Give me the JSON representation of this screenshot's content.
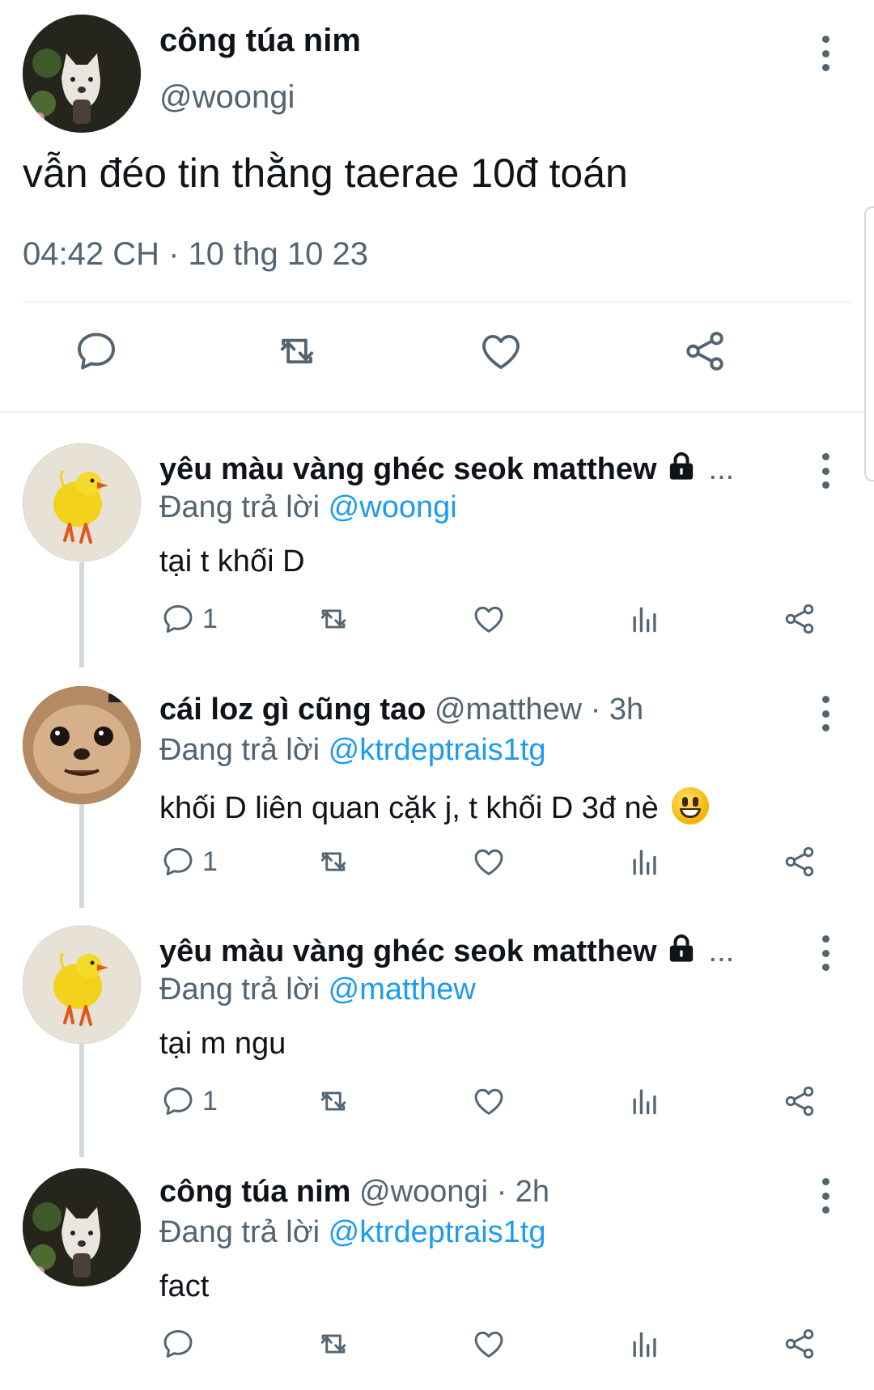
{
  "main_tweet": {
    "name": "công túa nim",
    "handle": "@woongi",
    "text": "vẫn đéo tin thằng taerae 10đ toán",
    "timestamp": "04:42 CH · 10 thg 10 23"
  },
  "replies": [
    {
      "name": "yêu màu vàng ghéc seok matthew",
      "meta": "",
      "protected": true,
      "truncated": "...",
      "replying_label": "Đang trả lời",
      "replying_to": "@woongi",
      "text": "tại t khối D",
      "reply_count": "1",
      "avatar_icon": "chick-avatar"
    },
    {
      "name": "cái loz gì cũng tao",
      "meta": "@matthew · 3h",
      "protected": false,
      "truncated": "",
      "replying_label": "Đang trả lời",
      "replying_to": "@ktrdeptrais1tg",
      "text": "khối D liên quan cặk j, t khối D 3đ nè",
      "emoji": "grinning-face-emoji",
      "reply_count": "1",
      "avatar_icon": "chihuahua-avatar"
    },
    {
      "name": "yêu màu vàng ghéc seok matthew",
      "meta": "",
      "protected": true,
      "truncated": "...",
      "replying_label": "Đang trả lời",
      "replying_to": "@matthew",
      "text": "tại m ngu",
      "reply_count": "1",
      "avatar_icon": "chick-avatar"
    },
    {
      "name": "công túa nim",
      "meta": "@woongi · 2h",
      "protected": false,
      "truncated": "",
      "replying_label": "Đang trả lời",
      "replying_to": "@ktrdeptrais1tg",
      "text": "fact",
      "reply_count": "",
      "avatar_icon": "dog-avatar"
    }
  ],
  "colors": {
    "text": "#0f1419",
    "secondary": "#536471",
    "link": "#1d9bf0",
    "divider": "#eff3f4",
    "thread_line": "#cfd9de"
  },
  "icons": {
    "reply": "reply-icon",
    "retweet": "retweet-icon",
    "like": "like-icon",
    "views": "views-icon",
    "share": "share-icon",
    "more": "more-vertical-icon",
    "lock": "lock-icon"
  }
}
